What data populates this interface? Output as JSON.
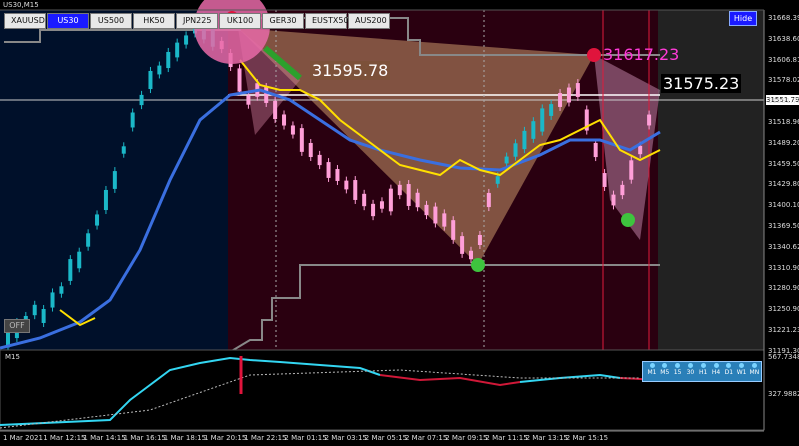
{
  "window_title": "US30,M15",
  "symbol_tabs": [
    {
      "label": "XAUUSD",
      "active": false
    },
    {
      "label": "US30",
      "active": true
    },
    {
      "label": "US500",
      "active": false
    },
    {
      "label": "HK50",
      "active": false
    },
    {
      "label": "JPN225",
      "active": false
    },
    {
      "label": "UK100",
      "active": false
    },
    {
      "label": "GER30",
      "active": false
    },
    {
      "label": "EUSTX50",
      "active": false
    },
    {
      "label": "AUS200",
      "active": false
    }
  ],
  "hide_button_label": "Hide",
  "off_button_label": "OFF",
  "indicator_title": "M15",
  "timeframes": [
    "M1",
    "M5",
    "15",
    "30",
    "H1",
    "H4",
    "D1",
    "W1",
    "MN"
  ],
  "price_axis": [
    "31668.39",
    "31638.60",
    "31606.81",
    "31578.02",
    "31551.79",
    "31518.96",
    "31489.20",
    "31459.50",
    "31429.80",
    "31400.10",
    "31369.50",
    "31340.62",
    "31310.90",
    "31280.90",
    "31250.90",
    "31221.23",
    "31191.30"
  ],
  "current_price": "31551.79",
  "indicator_axis": {
    "top": "567.7348",
    "bottom": "327.9882"
  },
  "time_axis": [
    "1 Mar 2021",
    "1 Mar 12:15",
    "1 Mar 14:15",
    "1 Mar 16:15",
    "1 Mar 18:15",
    "1 Mar 20:15",
    "1 Mar 22:15",
    "2 Mar 01:15",
    "2 Mar 03:15",
    "2 Mar 05:15",
    "2 Mar 07:15",
    "2 Mar 09:15",
    "2 Mar 11:15",
    "2 Mar 13:15",
    "2 Mar 15:15"
  ],
  "pattern_labels": {
    "left_shoulder": "31595.78",
    "right_top": "31617.23",
    "right": "31575.23"
  },
  "colors": {
    "background_left": "#00102a",
    "background_right": "#2a0010",
    "fib_fill": "#c8956a",
    "fast_ma": "#ffe000",
    "slow_ma": "#3a6fe0",
    "bull_candle": "#1bb8c8",
    "bear_candle": "#ff9fd8",
    "indicator_up": "#33d6f2",
    "indicator_down": "#d01838"
  }
}
